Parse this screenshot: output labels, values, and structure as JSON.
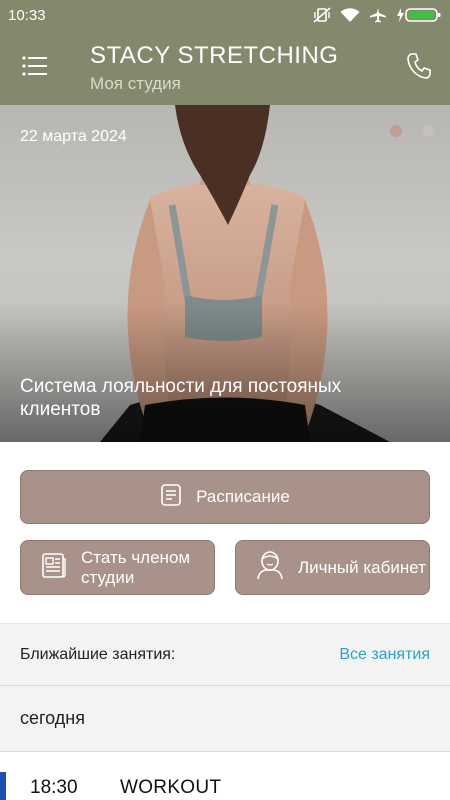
{
  "status_bar": {
    "time": "10:33",
    "icons": [
      "vibrate-off-icon",
      "wifi-icon",
      "airplane-icon",
      "battery-charging-icon"
    ]
  },
  "app_bar": {
    "title": "STACY STRETCHING",
    "subtitle": "Моя студия",
    "menu_icon": "menu-icon",
    "phone_icon": "phone-icon"
  },
  "banner": {
    "date": "22 марта 2024",
    "caption": "Система лояльности для постояных клиентов",
    "slides_count": 2,
    "active_slide": 1
  },
  "actions": {
    "schedule": "Расписание",
    "membership": "Стать членом студии",
    "cabinet": "Личный кабинет"
  },
  "upcoming": {
    "label": "Ближайшие занятия:",
    "all_link": "Все занятия"
  },
  "schedule": {
    "day_label": "сегодня",
    "classes": [
      {
        "time": "18:30",
        "name": "WORKOUT"
      }
    ]
  },
  "colors": {
    "header": "#83896d",
    "button": "#a89289",
    "link": "#2aa3c6",
    "accent": "#1d4fb0"
  }
}
